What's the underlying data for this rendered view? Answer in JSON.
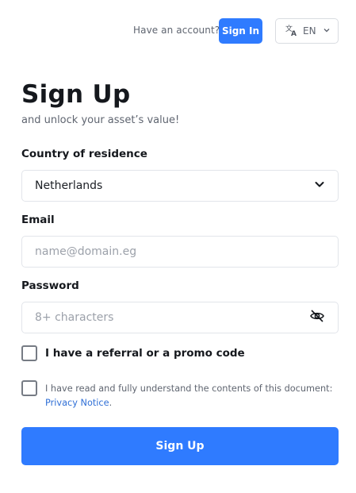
{
  "header": {
    "have_account_text": "Have an account?",
    "signin_label": "Sign In",
    "language_code": "EN",
    "language_icon": "translate-icon",
    "chevron_icon": "chevron-down-icon"
  },
  "form": {
    "title": "Sign Up",
    "subtitle": "and unlock your asset’s value!",
    "country": {
      "label": "Country of residence",
      "value": "Netherlands"
    },
    "email": {
      "label": "Email",
      "placeholder": "name@domain.eg",
      "value": ""
    },
    "password": {
      "label": "Password",
      "placeholder": "8+ characters",
      "value": "",
      "toggle_icon": "eye-off-icon"
    },
    "referral": {
      "label": "I have a referral or a promo code",
      "checked": false
    },
    "privacy": {
      "text": "I have read and fully understand the contents of this document:",
      "link_text": "Privacy Notice",
      "suffix": ".",
      "checked": false
    },
    "submit_label": "Sign Up"
  },
  "colors": {
    "accent": "#2f7bff",
    "link": "#2f6fd6",
    "text": "#15181d",
    "muted": "#5f6570"
  }
}
